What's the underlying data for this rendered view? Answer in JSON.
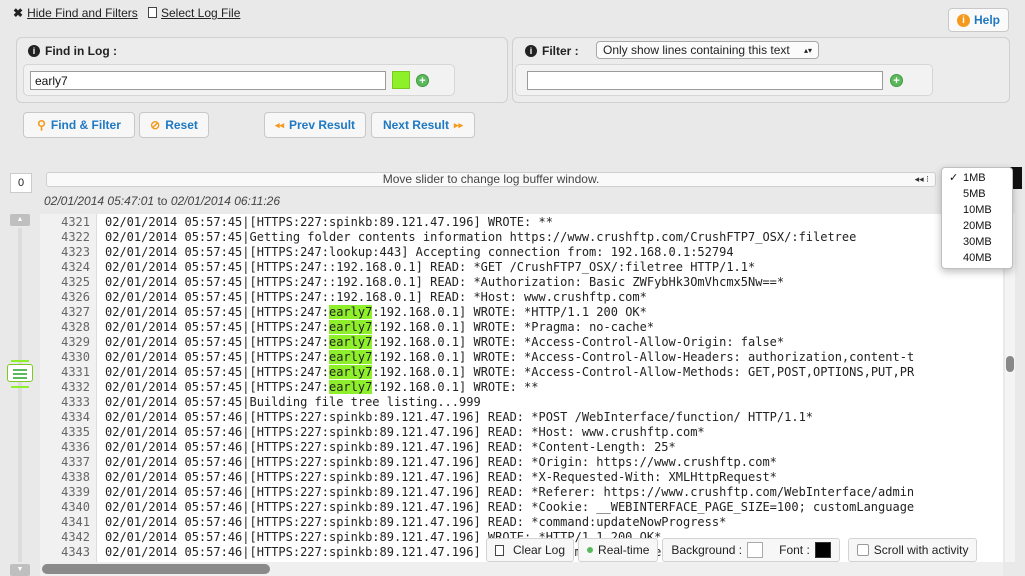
{
  "topbar": {
    "hide_label": "Hide Find and Filters",
    "select_log_label": "Select Log File",
    "help_label": "Help"
  },
  "find": {
    "label": "Find in Log :",
    "value": "early7",
    "highlight_color": "#8ef02a"
  },
  "filter": {
    "label": "Filter :",
    "mode": "Only show lines containing this text",
    "value": ""
  },
  "buttons": {
    "find_filter": "Find & Filter",
    "reset": "Reset",
    "prev": "Prev Result",
    "next": "Next Result"
  },
  "slider": {
    "start_value": "0",
    "text": "Move slider to change log buffer window.",
    "from": "02/01/2014 05:47:01",
    "to_word": "to",
    "to": "02/01/2014 06:11:26"
  },
  "buffer_options": [
    "1MB",
    "5MB",
    "10MB",
    "20MB",
    "30MB",
    "40MB"
  ],
  "buffer_selected": "1MB",
  "log_lines": [
    {
      "n": "4321",
      "pre": "02/01/2014 05:57:45|[HTTPS:227:spinkb:89.121.47.196] WROTE: **",
      "hl": "",
      "post": ""
    },
    {
      "n": "4322",
      "pre": "02/01/2014 05:57:45|Getting folder contents information https://www.crushftp.com/CrushFTP7_OSX/:filetree",
      "hl": "",
      "post": ""
    },
    {
      "n": "4323",
      "pre": "02/01/2014 05:57:45|[HTTPS:247:lookup:443] Accepting connection from: 192.168.0.1:52794",
      "hl": "",
      "post": ""
    },
    {
      "n": "4324",
      "pre": "02/01/2014 05:57:45|[HTTPS:247::192.168.0.1] READ: *GET /CrushFTP7_OSX/:filetree HTTP/1.1*",
      "hl": "",
      "post": ""
    },
    {
      "n": "4325",
      "pre": "02/01/2014 05:57:45|[HTTPS:247::192.168.0.1] READ: *Authorization: Basic ZWFybHk3OmVhcmx5Nw==*",
      "hl": "",
      "post": ""
    },
    {
      "n": "4326",
      "pre": "02/01/2014 05:57:45|[HTTPS:247::192.168.0.1] READ: *Host: www.crushftp.com*",
      "hl": "",
      "post": ""
    },
    {
      "n": "4327",
      "pre": "02/01/2014 05:57:45|[HTTPS:247:",
      "hl": "early7",
      "post": ":192.168.0.1] WROTE: *HTTP/1.1 200 OK*"
    },
    {
      "n": "4328",
      "pre": "02/01/2014 05:57:45|[HTTPS:247:",
      "hl": "early7",
      "post": ":192.168.0.1] WROTE: *Pragma: no-cache*"
    },
    {
      "n": "4329",
      "pre": "02/01/2014 05:57:45|[HTTPS:247:",
      "hl": "early7",
      "post": ":192.168.0.1] WROTE: *Access-Control-Allow-Origin: false*"
    },
    {
      "n": "4330",
      "pre": "02/01/2014 05:57:45|[HTTPS:247:",
      "hl": "early7",
      "post": ":192.168.0.1] WROTE: *Access-Control-Allow-Headers: authorization,content-t"
    },
    {
      "n": "4331",
      "pre": "02/01/2014 05:57:45|[HTTPS:247:",
      "hl": "early7",
      "post": ":192.168.0.1] WROTE: *Access-Control-Allow-Methods: GET,POST,OPTIONS,PUT,PR"
    },
    {
      "n": "4332",
      "pre": "02/01/2014 05:57:45|[HTTPS:247:",
      "hl": "early7",
      "post": ":192.168.0.1] WROTE: **"
    },
    {
      "n": "4333",
      "pre": "02/01/2014 05:57:45|Building file tree listing...999",
      "hl": "",
      "post": ""
    },
    {
      "n": "4334",
      "pre": "02/01/2014 05:57:46|[HTTPS:227:spinkb:89.121.47.196] READ: *POST /WebInterface/function/ HTTP/1.1*",
      "hl": "",
      "post": ""
    },
    {
      "n": "4335",
      "pre": "02/01/2014 05:57:46|[HTTPS:227:spinkb:89.121.47.196] READ: *Host: www.crushftp.com*",
      "hl": "",
      "post": ""
    },
    {
      "n": "4336",
      "pre": "02/01/2014 05:57:46|[HTTPS:227:spinkb:89.121.47.196] READ: *Content-Length: 25*",
      "hl": "",
      "post": ""
    },
    {
      "n": "4337",
      "pre": "02/01/2014 05:57:46|[HTTPS:227:spinkb:89.121.47.196] READ: *Origin: https://www.crushftp.com*",
      "hl": "",
      "post": ""
    },
    {
      "n": "4338",
      "pre": "02/01/2014 05:57:46|[HTTPS:227:spinkb:89.121.47.196] READ: *X-Requested-With: XMLHttpRequest*",
      "hl": "",
      "post": ""
    },
    {
      "n": "4339",
      "pre": "02/01/2014 05:57:46|[HTTPS:227:spinkb:89.121.47.196] READ: *Referer: https://www.crushftp.com/WebInterface/admin",
      "hl": "",
      "post": ""
    },
    {
      "n": "4340",
      "pre": "02/01/2014 05:57:46|[HTTPS:227:spinkb:89.121.47.196] READ: *Cookie: __WEBINTERFACE_PAGE_SIZE=100; customLanguage",
      "hl": "",
      "post": ""
    },
    {
      "n": "4341",
      "pre": "02/01/2014 05:57:46|[HTTPS:227:spinkb:89.121.47.196] READ: *command:updateNowProgress*",
      "hl": "",
      "post": ""
    },
    {
      "n": "4342",
      "pre": "02/01/2014 05:57:46|[HTTPS:227:spinkb:89.121.47.196] WROTE: *HTTP/1.1 200 OK*",
      "hl": "",
      "post": ""
    },
    {
      "n": "4343",
      "pre": "02/01/2014 05:57:46|[HTTPS:227:spinkb:89.121.47.196] WROTE: *Pragma: no-cache*",
      "hl": "",
      "post": ""
    }
  ],
  "bottom": {
    "clear_log": "Clear Log",
    "realtime": "Real-time",
    "background": "Background :",
    "font": "Font :",
    "scroll": "Scroll with activity"
  },
  "colors": {
    "accent": "#1e78c2",
    "help_icon": "#f39a1d",
    "highlight": "#8ef02a"
  }
}
